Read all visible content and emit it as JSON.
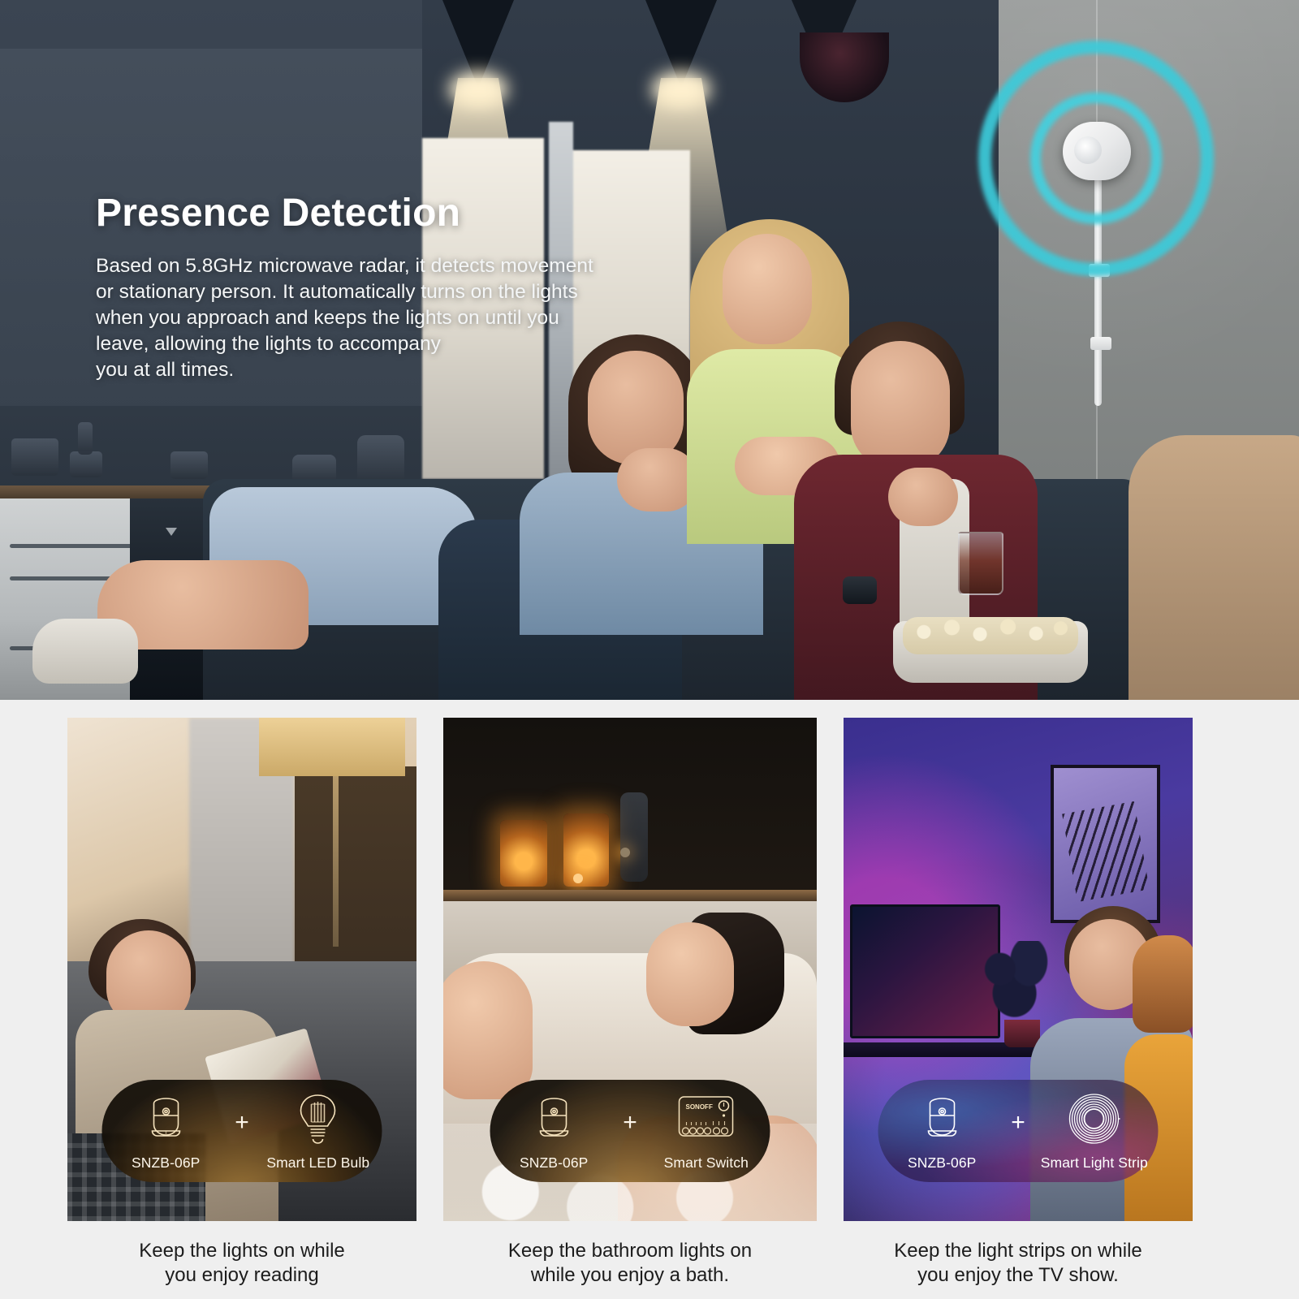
{
  "hero": {
    "title": "Presence Detection",
    "body_lines": [
      "Based on 5.8GHz microwave radar, it detects movement",
      "or stationary person. It automatically turns on the lights",
      "when you approach and keeps the lights on until you",
      "leave, allowing the lights to accompany",
      "you at all times."
    ],
    "device_icon": "presence-sensor-device",
    "radar_color": "#3ccbda"
  },
  "cards": [
    {
      "scene": "woman-reading-on-sofa",
      "badge": {
        "sensor_label": "SNZB-06P",
        "sensor_icon": "presence-sensor-icon",
        "plus": "+",
        "partner_label": "Smart LED Bulb",
        "partner_icon": "led-bulb-icon",
        "tone": "warm"
      },
      "caption_lines": [
        "Keep the lights on while",
        "you enjoy reading"
      ]
    },
    {
      "scene": "woman-in-bathtub-with-candles",
      "badge": {
        "sensor_label": "SNZB-06P",
        "sensor_icon": "presence-sensor-icon",
        "plus": "+",
        "partner_label": "Smart Switch",
        "partner_icon": "smart-switch-icon",
        "partner_brand": "SONOFF",
        "tone": "warm"
      },
      "caption_lines": [
        "Keep the bathroom lights on",
        "while you enjoy a bath."
      ]
    },
    {
      "scene": "couple-watching-tv-rgb-lighting",
      "badge": {
        "sensor_label": "SNZB-06P",
        "sensor_icon": "presence-sensor-icon",
        "plus": "+",
        "partner_label": "Smart Light Strip",
        "partner_icon": "light-strip-coil-icon",
        "tone": "cool"
      },
      "caption_lines": [
        "Keep the light strips on while",
        "you enjoy the TV show."
      ]
    }
  ],
  "colors": {
    "page_background": "#efefef",
    "hero_text": "#ffffff",
    "caption_text": "#1c1c1c",
    "radar_teal": "#3ccbda",
    "badge_warm_glow": "#ffba4a"
  }
}
